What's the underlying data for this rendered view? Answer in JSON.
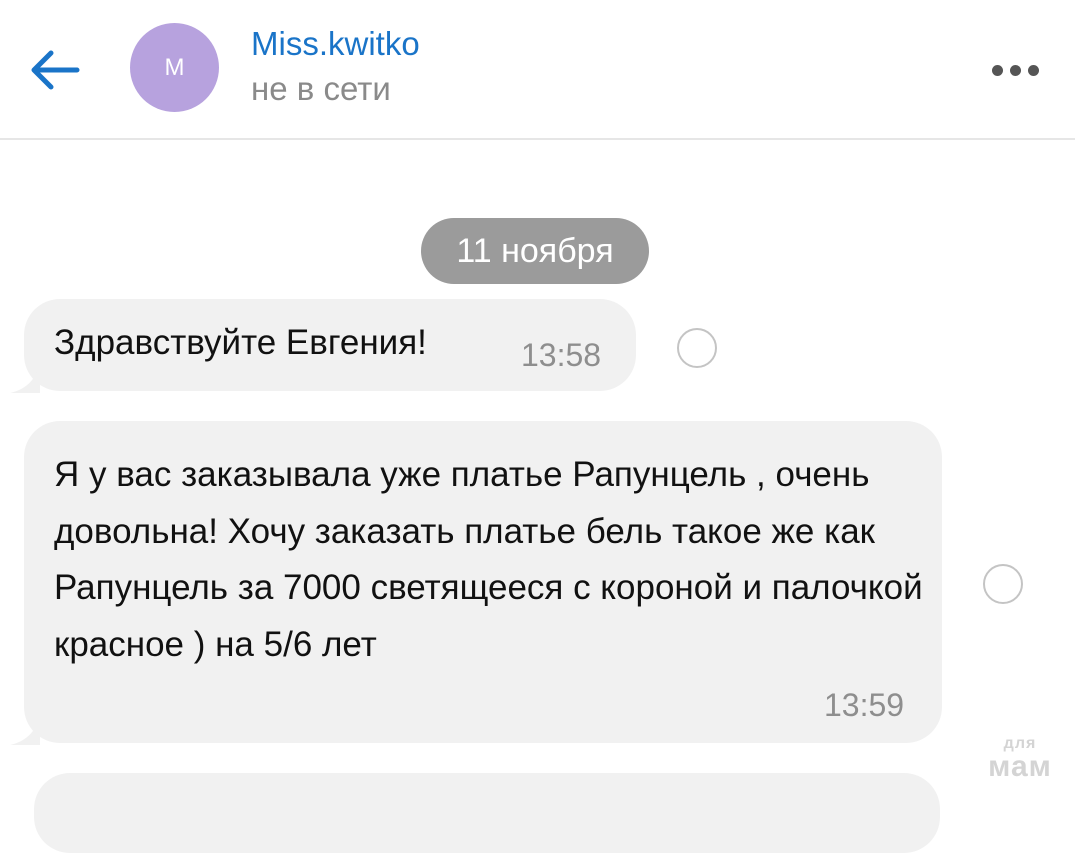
{
  "header": {
    "contact_name": "Miss.kwitko",
    "status": "не в сети",
    "avatar_letter": "М",
    "avatar_color": "#b7a2de",
    "accent_color": "#1a74c8",
    "back_icon": "arrow-left-icon",
    "more_icon": "more-horizontal-icon"
  },
  "chat": {
    "date_separator": "11 ноября",
    "date_separator_color": "#9b9b9b",
    "messages": [
      {
        "text": "Здравствуйте Евгения!",
        "time": "13:58"
      },
      {
        "text": "Я у вас заказывала уже платье Рапунцель , очень довольна! Хочу заказать платье бель такое же как Рапунцель за 7000 светящееся с короной и палочкой красное ) на 5/6 лет",
        "time": "13:59"
      }
    ]
  },
  "watermark": {
    "line1": "для",
    "line2": "мам"
  }
}
